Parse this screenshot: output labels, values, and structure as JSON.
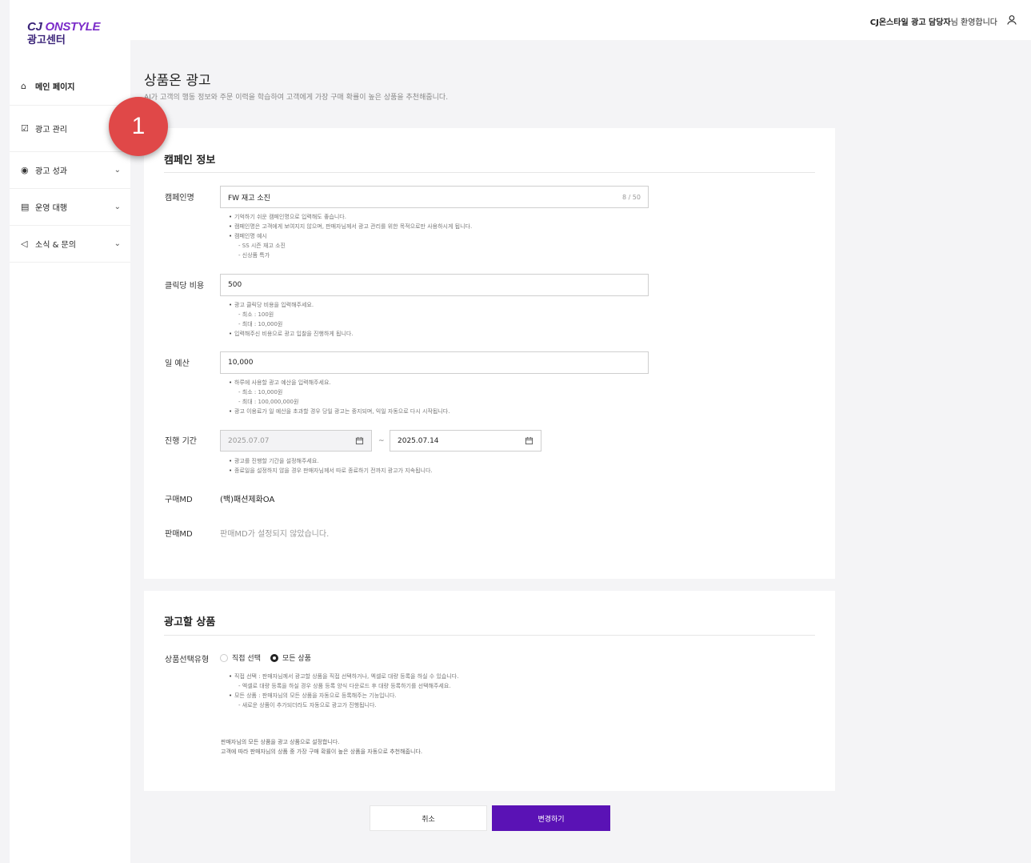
{
  "logo": {
    "brand_a": "CJ",
    "brand_b": "ONSTYLE",
    "sub": "광고센터"
  },
  "nav": [
    {
      "label": "메인 페이지",
      "icon": "home-icon"
    },
    {
      "label": "광고 관리",
      "icon": "ad-manage-icon"
    },
    {
      "label": "광고 성과",
      "icon": "performance-icon"
    },
    {
      "label": "운영 대행",
      "icon": "agency-icon"
    },
    {
      "label": "소식 & 문의",
      "icon": "megaphone-icon"
    }
  ],
  "header": {
    "welcome_bold": "CJ온스타일 광고 담당자",
    "welcome_rest": "님 환영합니다"
  },
  "page": {
    "title": "상품온 광고",
    "desc": "AI가 고객의 행동 정보와 주문 이력을 학습하여 고객에게 가장 구매 확률이 높은 상품을 추천해줍니다."
  },
  "badge": "1",
  "campaign": {
    "title": "캠페인 정보",
    "name_label": "캠페인명",
    "name_value": "FW 재고 소진",
    "name_count": "8 / 50",
    "name_help": [
      "기억하기 쉬운 캠페인명으로 입력해도 좋습니다.",
      "캠페인명은 고객에게 보여지지 않으며, 판매자님께서 광고 관리를 위한 목적으로만 사용하시게 됩니다.",
      "캠페인명 예시",
      "- SS 시즌 재고 소진",
      "- 신상품 특가"
    ],
    "cpc_label": "클릭당 비용",
    "cpc_value": "500",
    "cpc_help": [
      "광고 클릭당 비용을 입력해주세요.",
      "- 최소 : 100원",
      "- 최대 : 10,000원",
      "입력해주신 비용으로 광고 입찰을 진행하게 됩니다."
    ],
    "budget_label": "일 예산",
    "budget_value": "10,000",
    "budget_help": [
      "하루에 사용할 광고 예산을 입력해주세요.",
      "- 최소 : 10,000원",
      "- 최대 : 100,000,000원",
      "광고 이용료가 일 예산을 초과할 경우 당일 광고는 중지되며, 익일 자동으로 다시 시작됩니다."
    ],
    "period_label": "진행 기간",
    "period_start": "2025.07.07",
    "period_tilde": "~",
    "period_end": "2025.07.14",
    "period_help": [
      "광고를 진행할 기간을 설정해주세요.",
      "종료일을 설정하지 않을 경우 판매자님께서 따로 종료하기 전까지 광고가 지속됩니다."
    ],
    "buy_md_label": "구매MD",
    "buy_md_value": "(백)패션제화OA",
    "sell_md_label": "판매MD",
    "sell_md_value": "판매MD가 설정되지 않았습니다."
  },
  "products": {
    "title": "광고할 상품",
    "type_label": "상품선택유형",
    "option_direct": "직접 선택",
    "option_all": "모든 상품",
    "selected": "모든 상품",
    "help": [
      "직접 선택 : 판매자님께서 광고할 상품을 직접 선택하거나, 엑셀로 대량 등록을 하실 수 있습니다.",
      "- 엑셀로 대량 등록을 하실 경우 상품 등록 양식 다운로드 후 대량 등록하기를 선택해주세요.",
      "모든 상품 : 판매자님의 모든 상품을 자동으로 등록해주는 기능입니다.",
      "- 새로운 상품이 추가되더라도 자동으로 광고가 진행됩니다."
    ],
    "note_1": "판매자님의 모든 상품을 광고 상품으로 설정합니다.",
    "note_2": "고객에 따라 판매자님의 상품 중 가장 구매 확률이 높은 상품을 자동으로 추천해줍니다."
  },
  "buttons": {
    "cancel": "취소",
    "save": "변경하기"
  },
  "colors": {
    "brand": "#3a2378",
    "primary_button": "#5a12b5",
    "badge": "#e04848"
  }
}
